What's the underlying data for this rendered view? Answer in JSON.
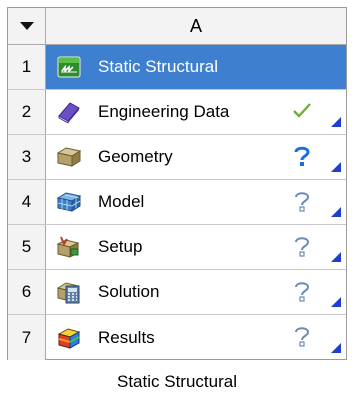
{
  "system": {
    "column_header": "A",
    "caption": "Static Structural",
    "rows": [
      {
        "num": "1",
        "label": "Static Structural",
        "icon": "static-structural-icon",
        "status": "none",
        "selected": true
      },
      {
        "num": "2",
        "label": "Engineering Data",
        "icon": "engineering-data-icon",
        "status": "up-to-date-check-icon",
        "selected": false
      },
      {
        "num": "3",
        "label": "Geometry",
        "icon": "geometry-icon",
        "status": "attention-required-icon",
        "selected": false
      },
      {
        "num": "4",
        "label": "Model",
        "icon": "model-icon",
        "status": "unfulfilled-icon",
        "selected": false
      },
      {
        "num": "5",
        "label": "Setup",
        "icon": "setup-icon",
        "status": "unfulfilled-icon",
        "selected": false
      },
      {
        "num": "6",
        "label": "Solution",
        "icon": "solution-icon",
        "status": "unfulfilled-icon",
        "selected": false
      },
      {
        "num": "7",
        "label": "Results",
        "icon": "results-icon",
        "status": "unfulfilled-icon",
        "selected": false
      }
    ]
  },
  "colors": {
    "selected_bg": "#3f7fd0",
    "check": "#6fae3c",
    "question_blue": "#1c6fe0",
    "question_gray": "#6a8ab8",
    "corner_arrow": "#1d3fd0"
  }
}
